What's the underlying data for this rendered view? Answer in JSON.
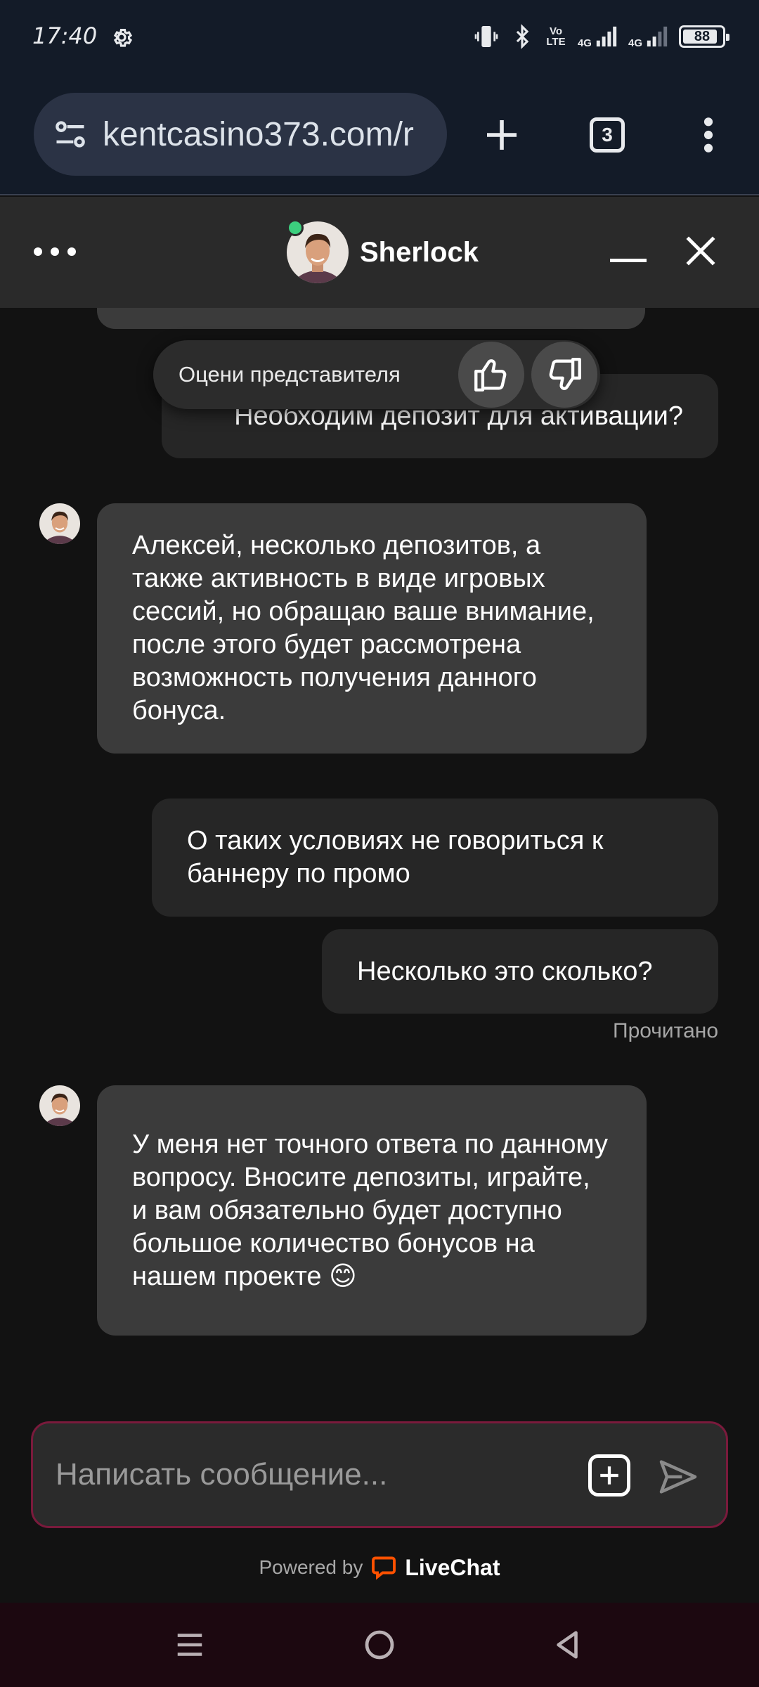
{
  "status_bar": {
    "time": "17:40",
    "net_volte": "Vo\nLTE",
    "net_4g_1": "4G",
    "net_4g_2": "4G",
    "battery": "88",
    "battery_level": 0.88,
    "icons": [
      "gear-icon",
      "vibrate-icon",
      "bluetooth-icon",
      "signal-icon",
      "signal-icon",
      "battery-icon"
    ]
  },
  "browser": {
    "url": "kentcasino373.com/r",
    "tabs_count": "3",
    "icons": [
      "site-settings-icon",
      "plus-icon",
      "tabs-icon",
      "more-vert-icon"
    ]
  },
  "chat_header": {
    "agent_name": "Sherlock",
    "status_color": "#3ccf7e",
    "icons": [
      "more-horizontal-icon",
      "minimize-icon",
      "close-icon"
    ]
  },
  "rating": {
    "label": "Оцени представителя",
    "icons": [
      "thumbs-up-icon",
      "thumbs-down-icon"
    ]
  },
  "messages": [
    {
      "from": "user",
      "text": "Необходим депозит для активации?"
    },
    {
      "from": "agent",
      "text": "Алексей, несколько депозитов, а также активность в виде игровых сессий, но обращаю ваше внимание, после этого будет рассмотрена возможность получения данного бонуса."
    },
    {
      "from": "user",
      "text": "О таких условиях не говориться к баннеру по промо"
    },
    {
      "from": "user",
      "text": "Несколько это сколько?"
    },
    {
      "from": "agent",
      "text": "У меня нет точного ответа по данному вопросу. Вносите депозиты, играйте, и вам обязательно будет доступно большое количество бонусов на нашем проекте 😊"
    }
  ],
  "read_status": "Прочитано",
  "composer": {
    "placeholder": "Написать сообщение...",
    "border_color": "#7a1a3c"
  },
  "footer": {
    "powered_by": "Powered by",
    "brand": "LiveChat",
    "brand_color": "#ff5100"
  },
  "system_nav": {
    "icons": [
      "menu-icon",
      "home-icon",
      "back-icon"
    ]
  }
}
